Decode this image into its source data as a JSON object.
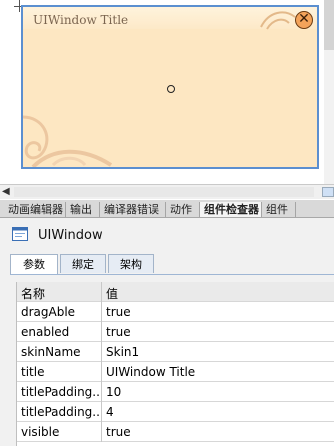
{
  "window": {
    "title": "UIWindow Title",
    "close_glyph": "✕",
    "colors": {
      "body": "#fde7c2",
      "border": "#5b8fd0",
      "title_text": "#7b6550",
      "close_button": "#f3a35a"
    }
  },
  "bottom_tabs": {
    "items": [
      {
        "label": "动画编辑器"
      },
      {
        "label": "输出"
      },
      {
        "label": "编译器错误"
      },
      {
        "label": "动作"
      },
      {
        "label": "组件检查器",
        "active": true
      },
      {
        "label": "组件"
      }
    ]
  },
  "inspector": {
    "component_name": "UIWindow",
    "component_icon": "window-icon",
    "sub_tabs": [
      {
        "label": "参数",
        "active": true
      },
      {
        "label": "绑定"
      },
      {
        "label": "架构"
      }
    ],
    "grid": {
      "headers": {
        "name": "名称",
        "value": "值"
      },
      "rows": [
        {
          "name": "dragAble",
          "value": "true"
        },
        {
          "name": "enabled",
          "value": "true"
        },
        {
          "name": "skinName",
          "value": "Skin1"
        },
        {
          "name": "title",
          "value": "UIWindow Title"
        },
        {
          "name": "titlePadding...",
          "value": "10"
        },
        {
          "name": "titlePadding...",
          "value": "4"
        },
        {
          "name": "visible",
          "value": "true"
        }
      ]
    }
  }
}
